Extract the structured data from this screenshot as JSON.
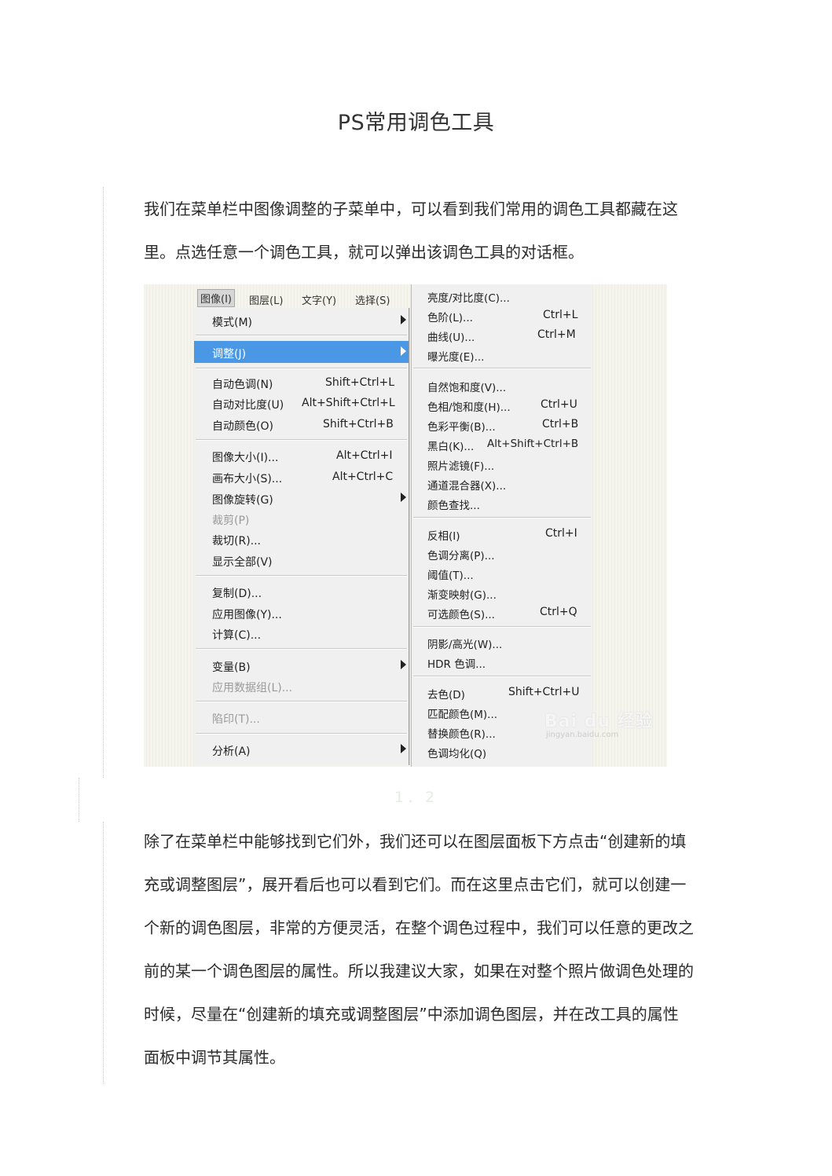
{
  "title": "PS常用调色工具",
  "paragraph1": "我们在菜单栏中图像调整的子菜单中，可以看到我们常用的调色工具都藏在这里。点选任意一个调色工具，就可以弹出该调色工具的对话框。",
  "step_label": "1．2",
  "paragraph2": "除了在菜单栏中能够找到它们外，我们还可以在图层面板下方点击“创建新的填充或调整图层”，展开看后也可以看到它们。而在这里点击它们，就可以创建一个新的调色图层，非常的方便灵活，在整个调色过程中，我们可以任意的更改之前的某一个调色图层的属性。所以我建议大家，如果在对整个照片做调色处理的时候，尽量在“创建新的填充或调整图层”中添加调色图层，并在改工具的属性面板中调节其属性。",
  "screenshot": {
    "menubar": [
      "图像(I)",
      "图层(L)",
      "文字(Y)",
      "选择(S)"
    ],
    "menu": [
      {
        "label": "模式(M)",
        "shortcut": "",
        "submenu": true
      },
      {
        "label": "调整(J)",
        "shortcut": "",
        "submenu": true,
        "highlighted": true
      },
      {
        "label": "自动色调(N)",
        "shortcut": "Shift+Ctrl+L"
      },
      {
        "label": "自动对比度(U)",
        "shortcut": "Alt+Shift+Ctrl+L"
      },
      {
        "label": "自动颜色(O)",
        "shortcut": "Shift+Ctrl+B"
      },
      {
        "label": "图像大小(I)...",
        "shortcut": "Alt+Ctrl+I"
      },
      {
        "label": "画布大小(S)...",
        "shortcut": "Alt+Ctrl+C"
      },
      {
        "label": "图像旋转(G)",
        "shortcut": "",
        "submenu": true
      },
      {
        "label": "裁剪(P)",
        "shortcut": "",
        "disabled": true
      },
      {
        "label": "裁切(R)...",
        "shortcut": ""
      },
      {
        "label": "显示全部(V)",
        "shortcut": ""
      },
      {
        "label": "复制(D)...",
        "shortcut": ""
      },
      {
        "label": "应用图像(Y)...",
        "shortcut": ""
      },
      {
        "label": "计算(C)...",
        "shortcut": ""
      },
      {
        "label": "变量(B)",
        "shortcut": "",
        "submenu": true
      },
      {
        "label": "应用数据组(L)...",
        "shortcut": "",
        "disabled": true
      },
      {
        "label": "陷印(T)...",
        "shortcut": "",
        "disabled": true
      },
      {
        "label": "分析(A)",
        "shortcut": "",
        "submenu": true
      }
    ],
    "submenu": [
      {
        "label": "亮度/对比度(C)...",
        "shortcut": ""
      },
      {
        "label": "色阶(L)...",
        "shortcut": "Ctrl+L"
      },
      {
        "label": "曲线(U)...",
        "shortcut": "Ctrl+M"
      },
      {
        "label": "曝光度(E)...",
        "shortcut": ""
      },
      {
        "label": "自然饱和度(V)...",
        "shortcut": ""
      },
      {
        "label": "色相/饱和度(H)...",
        "shortcut": "Ctrl+U"
      },
      {
        "label": "色彩平衡(B)...",
        "shortcut": "Ctrl+B"
      },
      {
        "label": "黑白(K)...",
        "shortcut": "Alt+Shift+Ctrl+B"
      },
      {
        "label": "照片滤镜(F)...",
        "shortcut": ""
      },
      {
        "label": "通道混合器(X)...",
        "shortcut": ""
      },
      {
        "label": "颜色查找...",
        "shortcut": ""
      },
      {
        "label": "反相(I)",
        "shortcut": "Ctrl+I"
      },
      {
        "label": "色调分离(P)...",
        "shortcut": ""
      },
      {
        "label": "阈值(T)...",
        "shortcut": ""
      },
      {
        "label": "渐变映射(G)...",
        "shortcut": ""
      },
      {
        "label": "可选颜色(S)...",
        "shortcut": "Ctrl+Q"
      },
      {
        "label": "阴影/高光(W)...",
        "shortcut": ""
      },
      {
        "label": "HDR 色调...",
        "shortcut": ""
      },
      {
        "label": "去色(D)",
        "shortcut": "Shift+Ctrl+U"
      },
      {
        "label": "匹配颜色(M)...",
        "shortcut": ""
      },
      {
        "label": "替换颜色(R)...",
        "shortcut": ""
      },
      {
        "label": "色调均化(Q)",
        "shortcut": ""
      }
    ],
    "watermark": "Bai du 经验",
    "watermark_sub": "jingyan.baidu.com",
    "highlight_color": "#4a97e6"
  }
}
